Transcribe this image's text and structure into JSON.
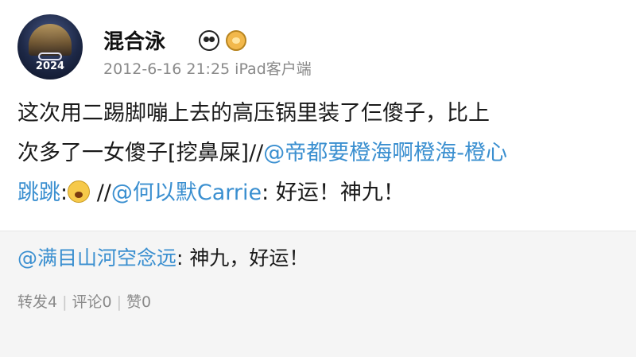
{
  "post": {
    "username": "混合泳",
    "avatar_year": "2024",
    "timestamp": "2012-6-16 21:25",
    "source": "iPad客户端",
    "badges": [
      "panda-icon",
      "fish-icon"
    ],
    "text_line1": "这次用二踢脚嘣上去的高压锅里装了仨傻子，比上",
    "text_line2_plain": "次多了一女傻子[挖鼻屎]//",
    "text_line2_link": "@帝都要橙海啊橙海-橙心",
    "text_line3_link1": "跳跳",
    "text_line3_sep": ":",
    "text_line3_sep2": " //",
    "text_line3_link2": "@何以默Carrie",
    "text_line3_rest": ": 好运！神九！"
  },
  "repost": {
    "author_link": "@满目山河空念远",
    "text": ": 神九，好运！",
    "stats": {
      "repost": "转发4",
      "comment": "评论0",
      "like": "赞0",
      "separator": "|"
    }
  },
  "colors": {
    "link": "#3a8fd0",
    "meta": "#8a8a8a",
    "repost_bg": "#f5f5f5"
  }
}
